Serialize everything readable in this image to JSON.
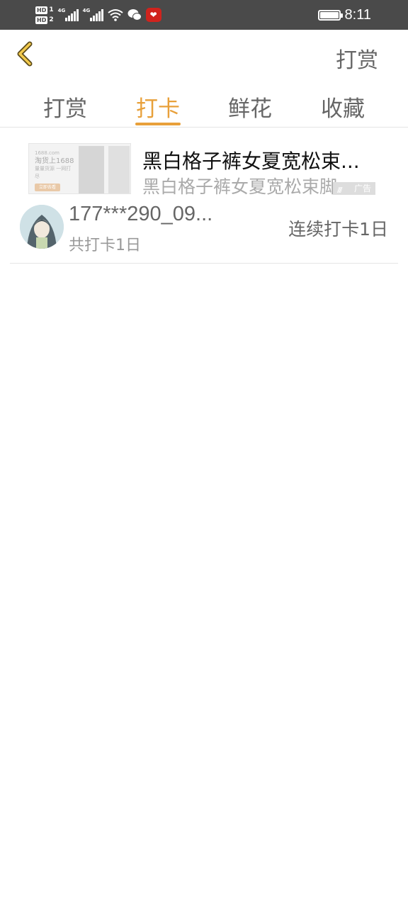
{
  "status_bar": {
    "hd1": "HD",
    "hd1_sub": "1",
    "hd2": "HD",
    "hd2_sub": "2",
    "net1": "4G",
    "net2": "4G",
    "time": "8:11"
  },
  "header": {
    "action_label": "打赏",
    "accent_color": "#e8a03a"
  },
  "tabs": [
    {
      "label": "打赏",
      "active": false
    },
    {
      "label": "打卡",
      "active": true
    },
    {
      "label": "鲜花",
      "active": false
    },
    {
      "label": "收藏",
      "active": false
    }
  ],
  "ad": {
    "thumb_brand": "1688.com",
    "thumb_title": "淘货上1688",
    "thumb_sub": "量量货源 一网打尽",
    "thumb_btn": "立即去看",
    "title": "黑白格子裤女夏宽松束...",
    "subtitle": "黑白格子裤女夏宽松束脚",
    "badge": "广告"
  },
  "checkin_list": [
    {
      "username": "177***290_09...",
      "total": "共打卡1日",
      "streak": "连续打卡1日"
    }
  ]
}
